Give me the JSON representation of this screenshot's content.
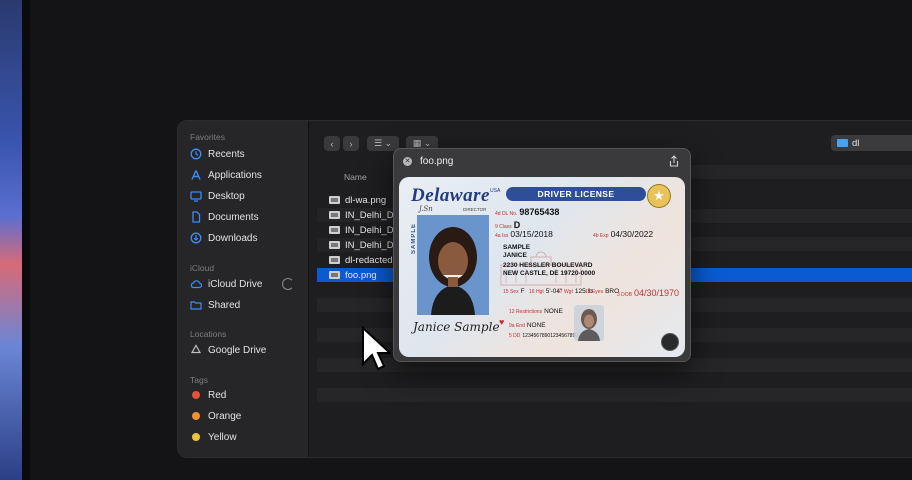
{
  "sidebar": {
    "favorites_header": "Favorites",
    "favorites": [
      {
        "label": "Recents",
        "icon": "clock-icon"
      },
      {
        "label": "Applications",
        "icon": "applications-icon"
      },
      {
        "label": "Desktop",
        "icon": "desktop-icon"
      },
      {
        "label": "Documents",
        "icon": "document-icon"
      },
      {
        "label": "Downloads",
        "icon": "download-icon"
      }
    ],
    "icloud_header": "iCloud",
    "icloud": [
      {
        "label": "iCloud Drive",
        "icon": "cloud-icon"
      },
      {
        "label": "Shared",
        "icon": "shared-folder-icon"
      }
    ],
    "locations_header": "Locations",
    "locations": [
      {
        "label": "Google Drive",
        "icon": "drive-icon"
      }
    ],
    "tags_header": "Tags",
    "tags": [
      {
        "label": "Red",
        "color": "#e0533f"
      },
      {
        "label": "Orange",
        "color": "#f0902f"
      },
      {
        "label": "Yellow",
        "color": "#e9c43a"
      }
    ]
  },
  "toolbar": {
    "path_folder": "dl"
  },
  "list": {
    "column_name": "Name",
    "files": [
      {
        "name": "dl-wa.png"
      },
      {
        "name": "IN_Delhi_D"
      },
      {
        "name": "IN_Delhi_D"
      },
      {
        "name": "IN_Delhi_D"
      },
      {
        "name": "dl-redacted"
      },
      {
        "name": "foo.png",
        "selected": true
      }
    ]
  },
  "quicklook": {
    "title": "foo.png",
    "card": {
      "state": "Delaware",
      "country": "USA",
      "doc_type": "DRIVER LICENSE",
      "director_label": "DIRECTOR",
      "sample_vertical": "SAMPLE",
      "dl_label": "4d DL No.",
      "dl_no": "98765438",
      "class_label": "9 Class",
      "class": "D",
      "iss_label": "4a Iss",
      "iss": "03/15/2018",
      "exp_label": "4b Exp",
      "exp": "04/30/2022",
      "last_name": "SAMPLE",
      "first_name": "JANICE",
      "address1": "2230 HESSLER BOULEVARD",
      "address2": "NEW CASTLE, DE 19720-0000",
      "sex_label": "15 Sex",
      "sex": "F",
      "hgt_label": "16 Hgt",
      "hgt": "5'-04\"",
      "wgt_label": "17 Wgt",
      "wgt": "125 lb",
      "eyes_label": "18 Eyes",
      "eyes": "BRO",
      "dob_label": "3 DOB",
      "dob": "04/30/1970",
      "restrictions_label": "12 Restrictions",
      "restrictions": "NONE",
      "end_label": "9a End",
      "endorsements": "NONE",
      "dd_label": "5 DD",
      "dd": "12345678901234567890",
      "signature": "Janice Sample"
    }
  }
}
